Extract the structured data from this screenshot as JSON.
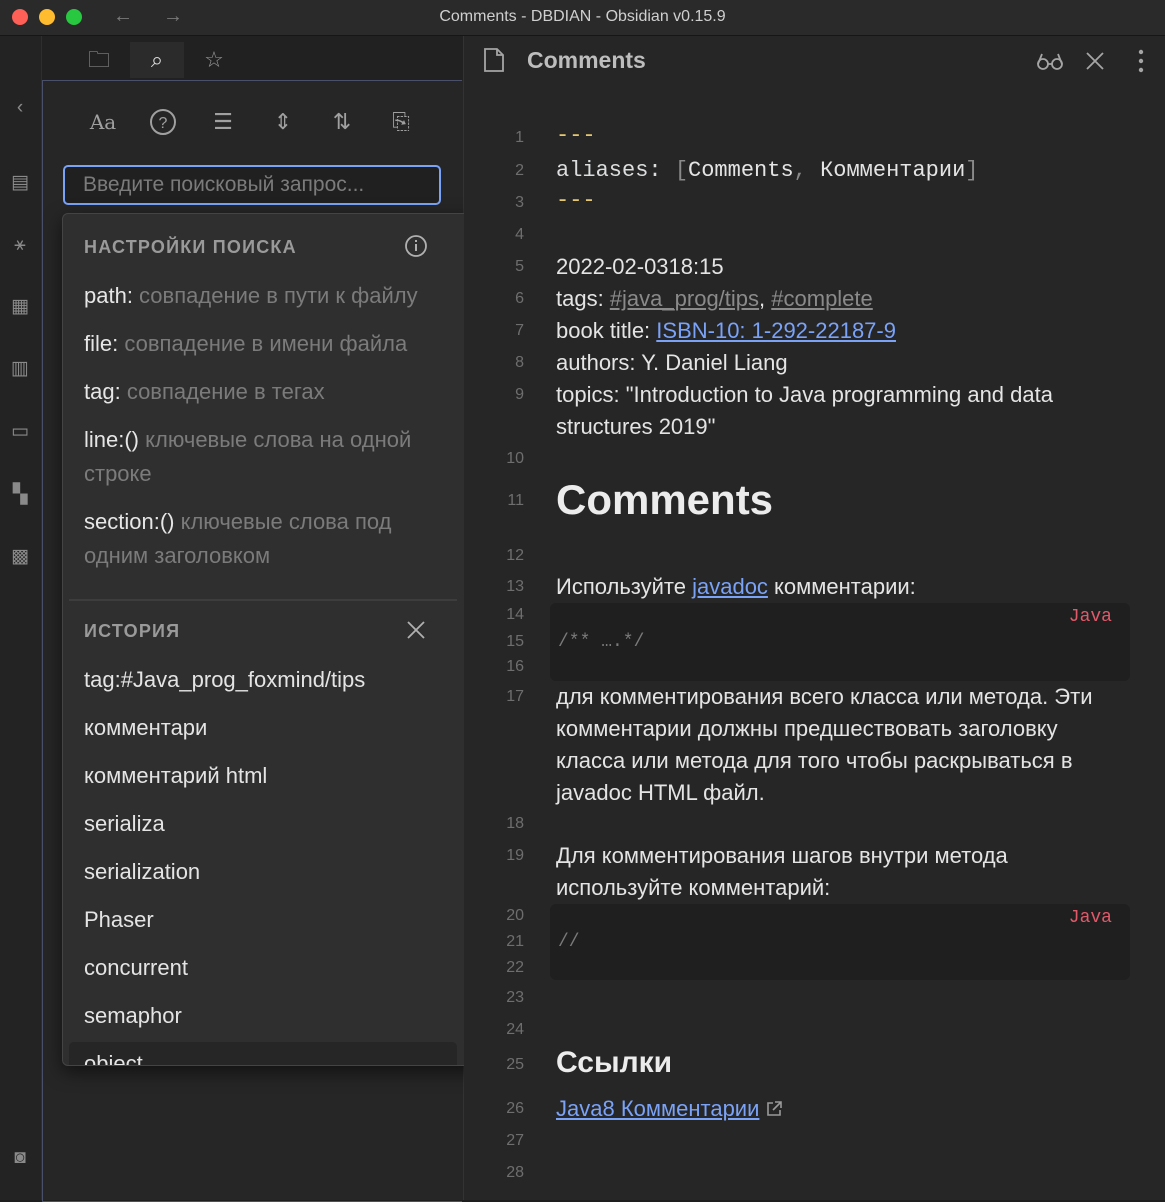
{
  "window": {
    "title": "Comments - DBDIAN - Obsidian v0.15.9",
    "back": "←",
    "forward": "→"
  },
  "left_tabs": [
    {
      "icon": "folder-icon",
      "glyph": "🗀"
    },
    {
      "icon": "search-icon",
      "glyph": "⌕"
    },
    {
      "icon": "star-icon",
      "glyph": "☆"
    }
  ],
  "search_toolbar": [
    {
      "icon": "match-case-icon",
      "glyph": "Aa"
    },
    {
      "icon": "help-icon",
      "glyph": "?"
    },
    {
      "icon": "list-icon",
      "glyph": "☰"
    },
    {
      "icon": "collapse-icon",
      "glyph": "⇕"
    },
    {
      "icon": "sort-icon",
      "glyph": "⇅"
    },
    {
      "icon": "copy-icon",
      "glyph": "⎘"
    }
  ],
  "search": {
    "placeholder": "Введите поисковый запрос..."
  },
  "popover": {
    "options_header": "НАСТРОЙКИ ПОИСКА",
    "options": [
      {
        "key": "path:",
        "desc": " совпадение в пути к файлу"
      },
      {
        "key": "file:",
        "desc": " совпадение в имени файла"
      },
      {
        "key": "tag:",
        "desc": " совпадение в тегах"
      },
      {
        "key": "line:()",
        "desc": " ключевые слова на одной строке"
      },
      {
        "key": "section:()",
        "desc": " ключевые слова под одним заголовком"
      }
    ],
    "history_header": "ИСТОРИЯ",
    "history": [
      "tag:#Java_prog_foxmind/tips",
      "комментари",
      "комментарий html",
      "serializa",
      "serialization",
      "Phaser",
      "concurrent",
      "semaphor",
      "object"
    ]
  },
  "editor": {
    "tab_title": "Comments",
    "line_numbers": [
      "1",
      "2",
      "3",
      "4",
      "5",
      "6",
      "7",
      "8",
      "9",
      "10",
      "11",
      "12",
      "13",
      "14",
      "15",
      "16",
      "17",
      "18",
      "19",
      "20",
      "21",
      "22",
      "23",
      "24",
      "25",
      "26",
      "27",
      "28"
    ],
    "fm_dash": "---",
    "fm_aliases_key": "aliases:",
    "fm_aliases_open": "[",
    "fm_aliases_v1": "Comments",
    "fm_comma": ",",
    "fm_aliases_v2": "Комментарии",
    "fm_aliases_close": "]",
    "date": "2022-02-0318:15",
    "tags_label": "tags: ",
    "tag1": "#java_prog/tips",
    "tags_comma": ", ",
    "tag2": "#complete",
    "book_label": "book title: ",
    "book_link": " ISBN-10: 1-292-22187-9",
    "authors": "authors: Y. Daniel Liang",
    "topics_1": "topics: \"Introduction to Java programming and data",
    "topics_2": "structures 2019\"",
    "h1": "Comments",
    "use_pre": "Используйте ",
    "use_link": " javadoc",
    "use_post": " комментарии:",
    "code_lang": "Java",
    "code1": "/** ….*/",
    "para1": [
      "для комментирования всего класса или метода. Эти",
      "комментарии должны предшествовать заголовку",
      "класса или метода для того чтобы раскрываться в",
      "javadoc HTML файл."
    ],
    "para2": [
      "Для комментирования шагов внутри метода",
      "используйте комментарий:"
    ],
    "code2": "//",
    "h2": "Ссылки",
    "ref_link": "Java8 Комментарии"
  }
}
